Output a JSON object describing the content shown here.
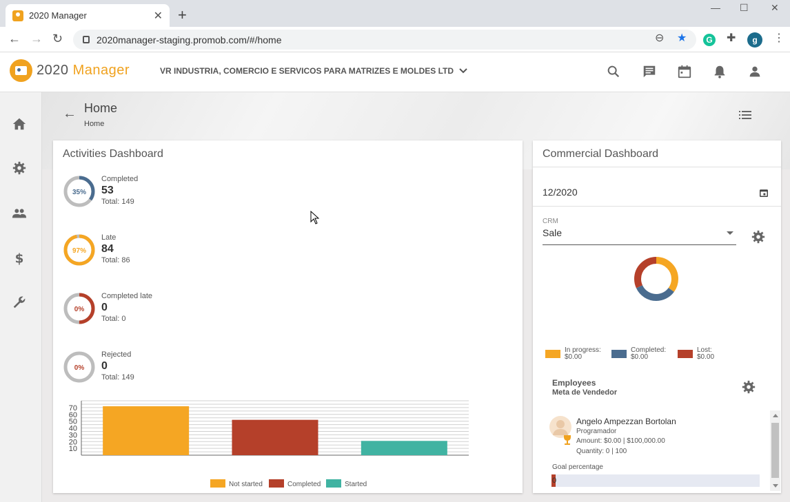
{
  "browser": {
    "tab_title": "2020 Manager",
    "tab_close": "✕",
    "new_tab": "+",
    "url": "2020manager-staging.promob.com/#/home",
    "profile_initial": "g",
    "grammarly_initial": "G"
  },
  "header": {
    "logo_prefix": "2020",
    "logo_suffix": "Manager",
    "company": "VR INDUSTRIA, COMERCIO E SERVICOS PARA MATRIZES E MOLDES LTD",
    "icons": [
      "search-icon",
      "chat-icon",
      "calendar-icon",
      "bell-icon",
      "account-icon"
    ]
  },
  "sidebar": {
    "items": [
      "home-icon",
      "settings-icon",
      "people-icon",
      "dollar-icon",
      "wrench-icon"
    ]
  },
  "page": {
    "title": "Home",
    "breadcrumb": "Home"
  },
  "activities": {
    "title": "Activities Dashboard",
    "items": [
      {
        "label": "Completed",
        "value": "53",
        "total": "Total: 149",
        "percent": "35%",
        "fraction": 0.35,
        "color": "#4a6c8f"
      },
      {
        "label": "Late",
        "value": "84",
        "total": "Total: 86",
        "percent": "97%",
        "fraction": 0.97,
        "color": "#f5a623"
      },
      {
        "label": "Completed late",
        "value": "0",
        "total": "Total: 0",
        "percent": "0%",
        "fraction": 0.5,
        "color": "#b5402a"
      },
      {
        "label": "Rejected",
        "value": "0",
        "total": "Total: 149",
        "percent": "0%",
        "fraction": 0.0,
        "color": "#b5402a"
      }
    ]
  },
  "chart_data": {
    "type": "bar",
    "categories": [
      "Not started",
      "Completed",
      "Started"
    ],
    "values": [
      72,
      52,
      21
    ],
    "colors": [
      "#f5a623",
      "#b5402a",
      "#40b3a2"
    ],
    "ylim": [
      0,
      80
    ],
    "yticks": [
      "10",
      "20",
      "30",
      "40",
      "50",
      "60",
      "70"
    ],
    "grid": true,
    "legend": "bottom"
  },
  "commercial": {
    "title": "Commercial Dashboard",
    "date": "12/2020",
    "crm_label": "CRM",
    "crm_value": "Sale",
    "donut": [
      {
        "name": "In progress",
        "fraction": 0.35,
        "color": "#f5a623"
      },
      {
        "name": "Completed",
        "fraction": 0.33,
        "color": "#4a6c8f"
      },
      {
        "name": "Lost",
        "fraction": 0.32,
        "color": "#b5402a"
      }
    ],
    "legend": [
      {
        "label": "In progress:",
        "amount": "$0.00",
        "color": "#f5a623"
      },
      {
        "label": "Completed:",
        "amount": "$0.00",
        "color": "#4a6c8f"
      },
      {
        "label": "Lost:",
        "amount": "$0.00",
        "color": "#b5402a"
      }
    ],
    "employees_title": "Employees",
    "employees_subtitle": "Meta de Vendedor",
    "employee": {
      "name": "Angelo Ampezzan Bortolan",
      "role": "Programador",
      "amount": "Amount: $0.00 | $100,000.00",
      "quantity": "Quantity: 0 | 100"
    },
    "goal_label": "Goal percentage",
    "goal_value": "0",
    "goal_fraction": 0.0
  }
}
